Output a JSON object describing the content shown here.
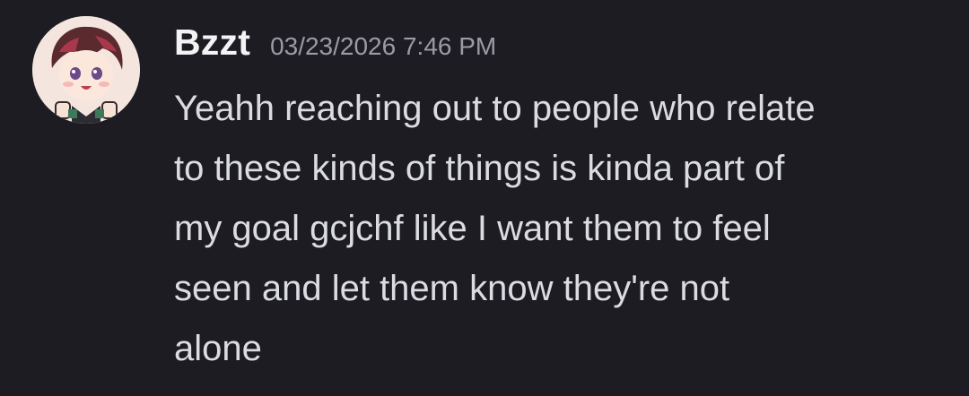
{
  "message": {
    "author": "Bzzt",
    "timestamp": "03/23/2026 7:46 PM",
    "avatar_icon": "anime-character-avatar",
    "lines": [
      "Yeahh reaching out to people who relate",
      "to these kinds of things is kinda part of",
      "my goal gcjchf like I want them to feel",
      "seen and let them know they're not",
      "alone"
    ]
  },
  "colors": {
    "background": "#1c1c22",
    "username": "#f3f3f5",
    "timestamp": "#9a9ba4",
    "text": "#dbdce2"
  }
}
